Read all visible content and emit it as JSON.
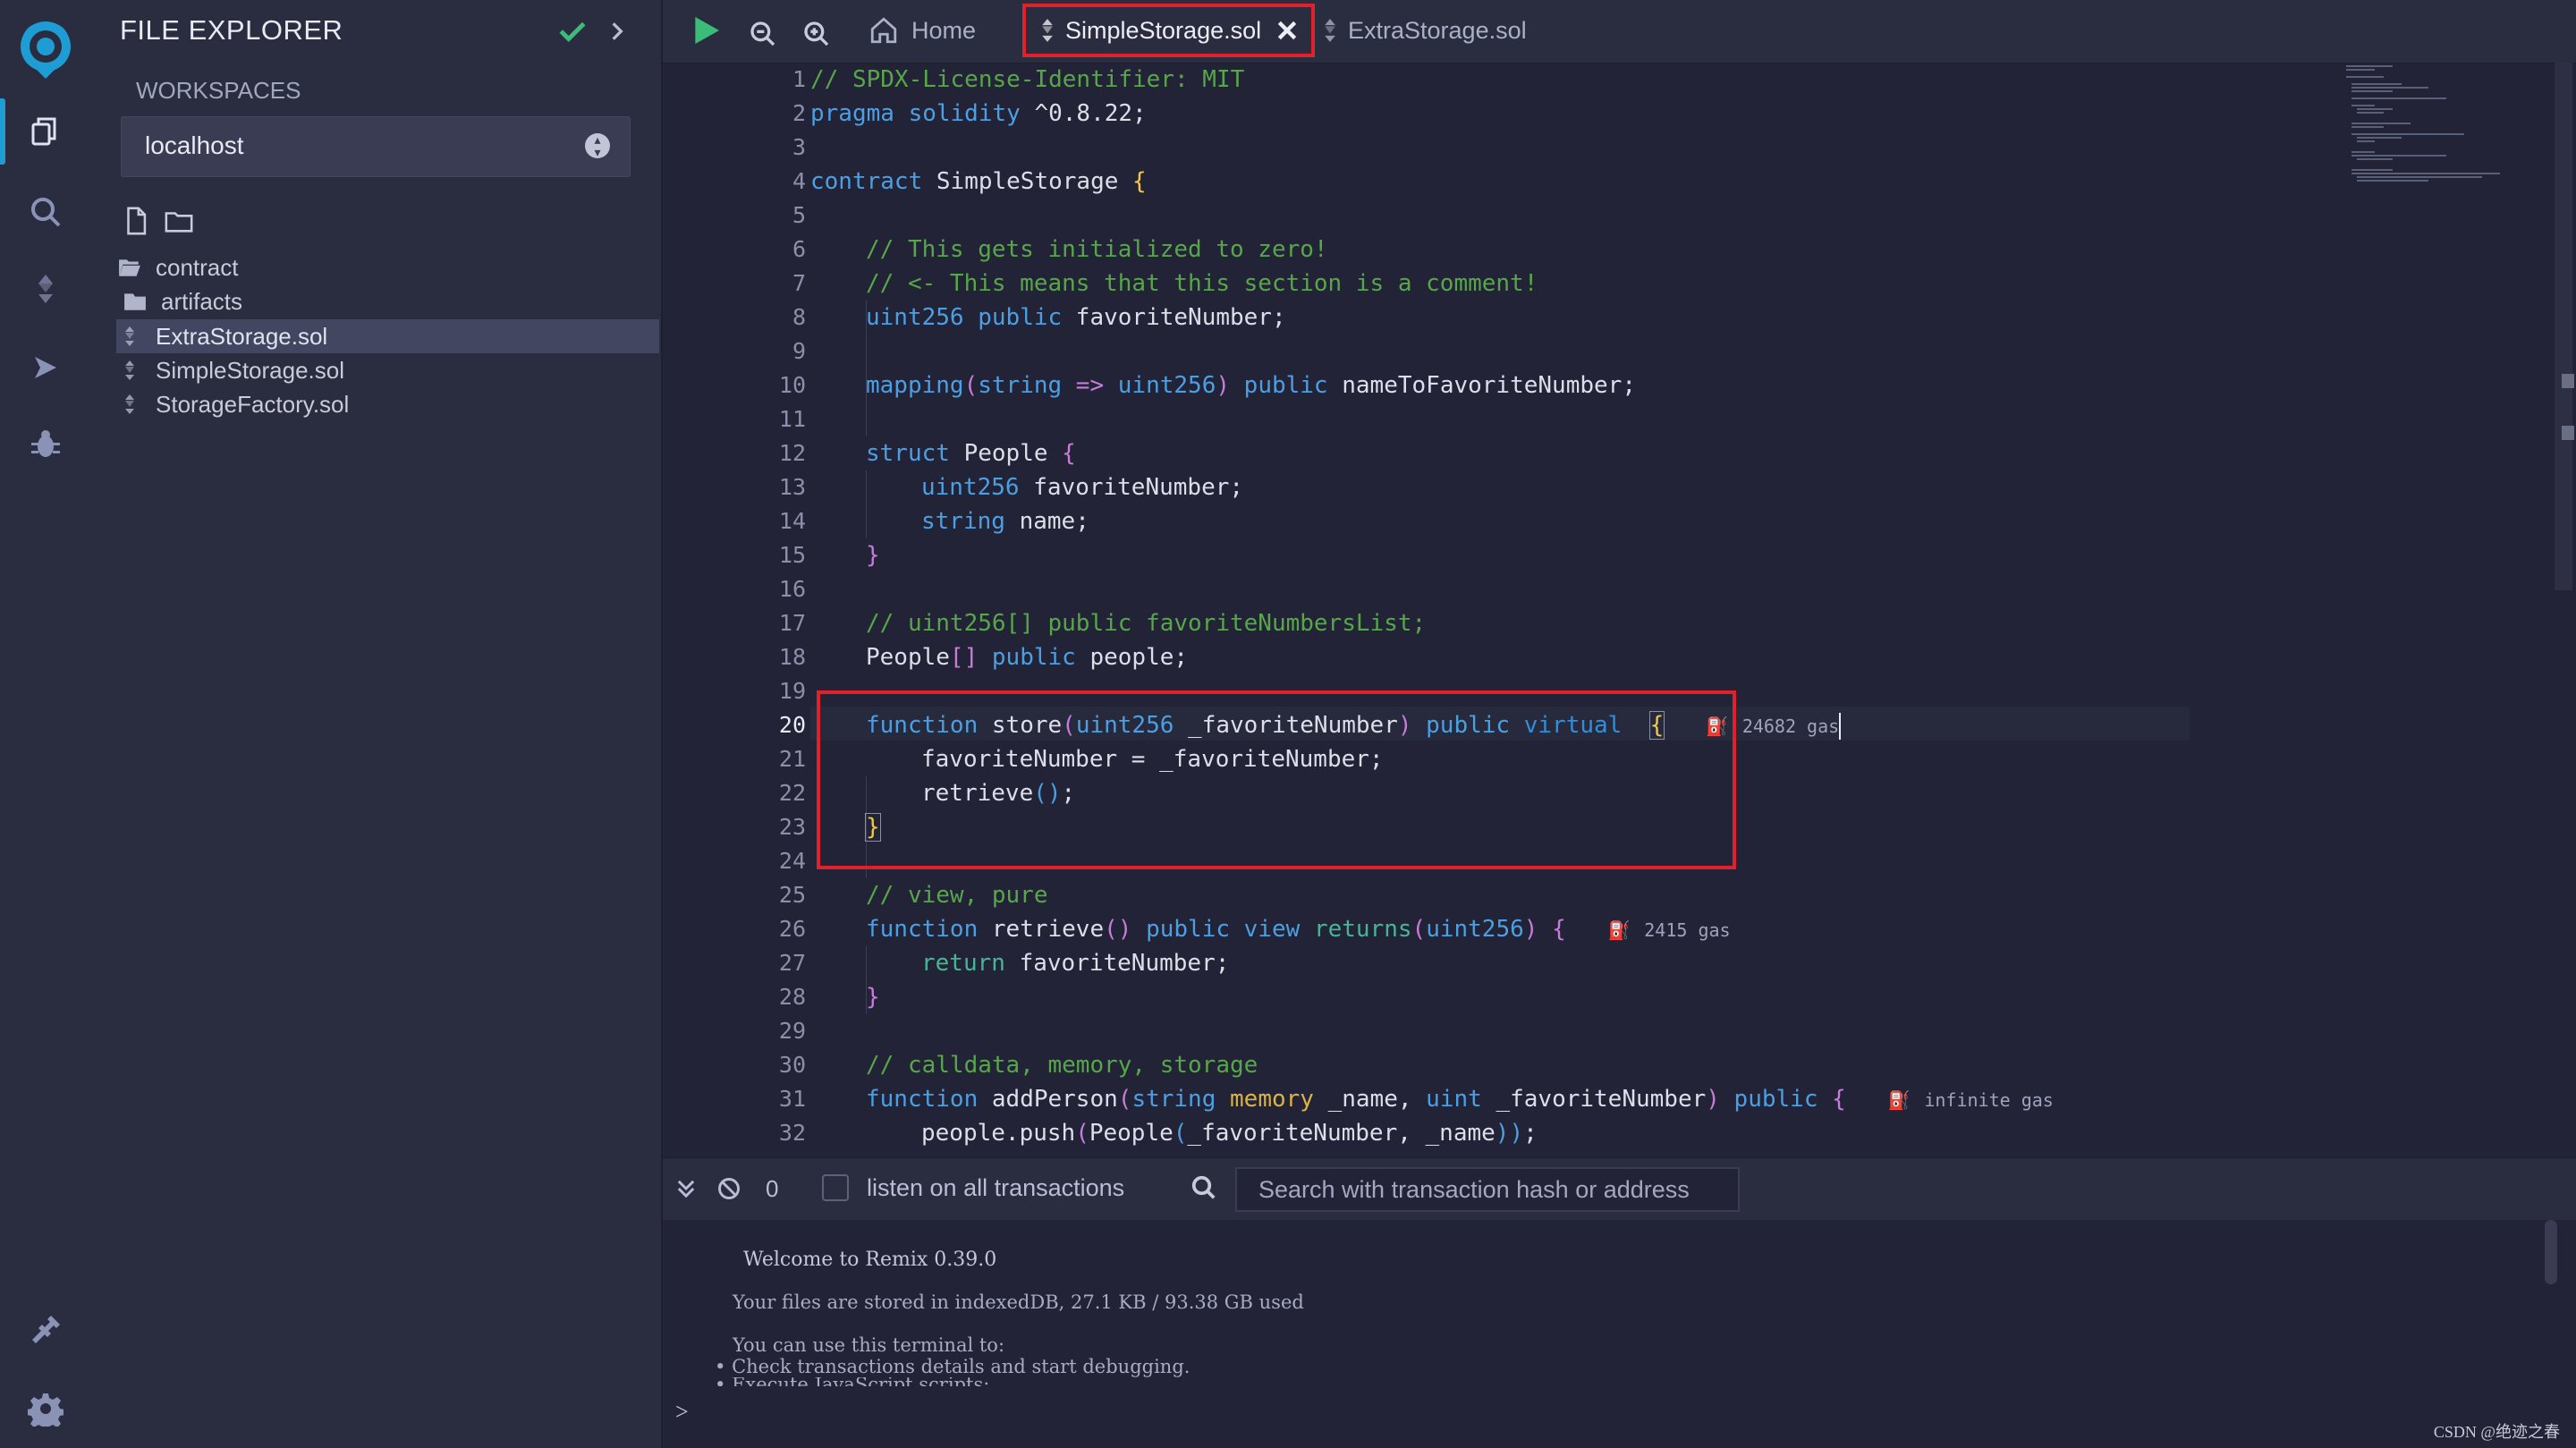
{
  "app": {
    "name": "Remix IDE"
  },
  "iconbar": {
    "items": [
      {
        "name": "remix-logo-icon"
      },
      {
        "name": "file-explorer-icon"
      },
      {
        "name": "search-icon"
      },
      {
        "name": "solidity-compiler-icon"
      },
      {
        "name": "deploy-run-icon"
      },
      {
        "name": "debugger-icon"
      },
      {
        "name": "plugin-manager-icon"
      },
      {
        "name": "settings-icon"
      }
    ]
  },
  "explorer": {
    "title": "FILE EXPLORER",
    "workspaces_label": "WORKSPACES",
    "workspace_selected": "localhost",
    "tree": [
      {
        "label": "contract",
        "type": "folder-open"
      },
      {
        "label": "artifacts",
        "type": "folder"
      },
      {
        "label": "ExtraStorage.sol",
        "type": "sol",
        "selected": true
      },
      {
        "label": "SimpleStorage.sol",
        "type": "sol"
      },
      {
        "label": "StorageFactory.sol",
        "type": "sol"
      }
    ]
  },
  "tabs": {
    "home": "Home",
    "active": "SimpleStorage.sol",
    "other": "ExtraStorage.sol"
  },
  "editor": {
    "current_line": 20,
    "line_numbers": [
      "1",
      "2",
      "3",
      "4",
      "5",
      "6",
      "7",
      "8",
      "9",
      "10",
      "11",
      "12",
      "13",
      "14",
      "15",
      "16",
      "17",
      "18",
      "19",
      "20",
      "21",
      "22",
      "23",
      "24",
      "25",
      "26",
      "27",
      "28",
      "29",
      "30",
      "31",
      "32"
    ],
    "code": {
      "l1": "// SPDX-License-Identifier: MIT",
      "l2_kw": "pragma solidity",
      "l2_ver": " ^0.8.22;",
      "l4_kw": "contract",
      "l4_name": " SimpleStorage ",
      "l4_br": "{",
      "l6": "// This gets initialized to zero!",
      "l7": "// <- This means that this section is a comment!",
      "l8_t": "uint256",
      "l8_p": " public",
      "l8_n": " favoriteNumber;",
      "l10_m": "mapping",
      "l10_a": "(",
      "l10_s": "string",
      "l10_arrow": " => ",
      "l10_u": "uint256",
      "l10_b": ")",
      "l10_p": " public",
      "l10_n": " nameToFavoriteNumber;",
      "l12_kw": "struct",
      "l12_n": " People ",
      "l12_br": "{",
      "l13_t": "uint256",
      "l13_n": " favoriteNumber;",
      "l14_t": "string",
      "l14_n": " name;",
      "l15": "}",
      "l17": "// uint256[] public favoriteNumbersList;",
      "l18_n": "People",
      "l18_b": "[]",
      "l18_p": " public",
      "l18_r": " people;",
      "l20_f": "function",
      "l20_n": " store",
      "l20_o": "(",
      "l20_t": "uint256",
      "l20_a": " _favoriteNumber",
      "l20_c": ")",
      "l20_p": " public",
      "l20_v": " virtual",
      "l20_br": "{",
      "l20_gas": "24682 gas",
      "l21": "favoriteNumber = _favoriteNumber;",
      "l22_n": "retrieve",
      "l22_b": "()",
      "l22_e": ";",
      "l23": "}",
      "l25": "// view, pure",
      "l26_f": "function",
      "l26_n": " retrieve",
      "l26_b": "()",
      "l26_p": " public",
      "l26_v": " view",
      "l26_r": " returns",
      "l26_o": "(",
      "l26_t": "uint256",
      "l26_c": ")",
      "l26_br": " {",
      "l26_gas": "2415 gas",
      "l27_r": "return",
      "l27_n": " favoriteNumber;",
      "l28": "}",
      "l30": "// calldata, memory, storage",
      "l31_f": "function",
      "l31_n": " addPerson",
      "l31_o": "(",
      "l31_s": "string",
      "l31_m": " memory",
      "l31_a": " _name,",
      "l31_u": " uint",
      "l31_b": " _favoriteNumber",
      "l31_c": ")",
      "l31_p": " public",
      "l31_br": " {",
      "l31_gas": "infinite gas",
      "l32_a": "people.push",
      "l32_o": "(",
      "l32_b": "People",
      "l32_c": "(",
      "l32_d": "_favoriteNumber, _name",
      "l32_e": "))",
      "l32_f": ";"
    }
  },
  "terminal": {
    "pending_count": "0",
    "listen_label": "listen on all transactions",
    "search_placeholder": "Search with transaction hash or address",
    "welcome": "Welcome to Remix 0.39.0",
    "storage": "Your files are stored in indexedDB, 27.1 KB / 93.38 GB used",
    "can_use": "You can use this terminal to:",
    "bullet1": "Check transactions details and start debugging.",
    "bullet2": "Execute JavaScript scripts:",
    "prompt": ">"
  },
  "watermark": "CSDN @绝迹之春",
  "colors": {
    "accent": "#1e9cd4",
    "highlight_red": "#e0202a",
    "check_green": "#3bbd7a"
  }
}
